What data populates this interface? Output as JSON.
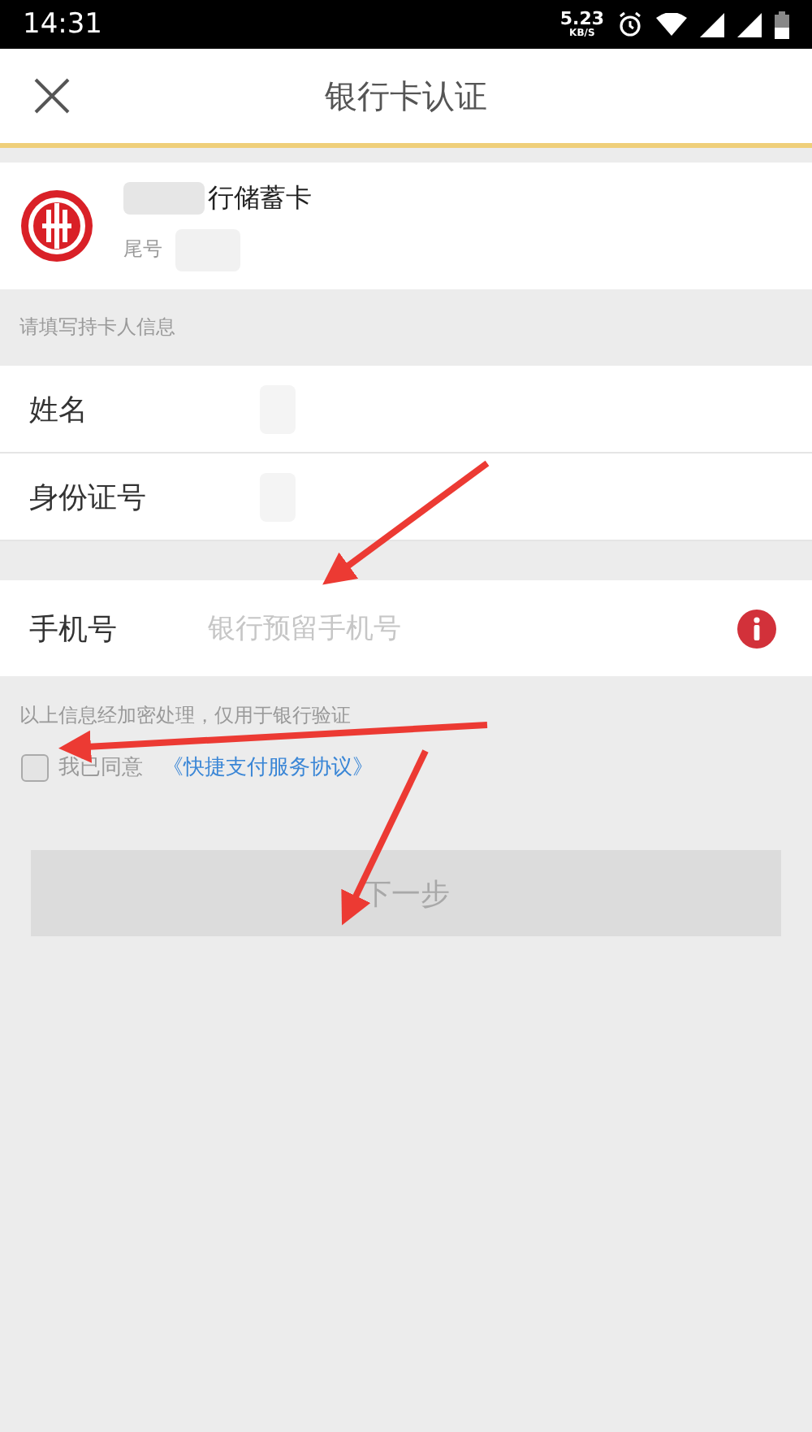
{
  "status_bar": {
    "time": "14:31",
    "speed": "5.23",
    "speed_unit": "KB/S"
  },
  "header": {
    "title": "银行卡认证"
  },
  "card": {
    "bank_name": "行储蓄卡",
    "tail_label": "尾号"
  },
  "section_label": "请填写持卡人信息",
  "fields": [
    {
      "label": "姓名",
      "kind": "blurred"
    },
    {
      "label": "身份证号",
      "kind": "blurred"
    }
  ],
  "phone": {
    "label": "手机号",
    "placeholder": "银行预留手机号"
  },
  "note": "以上信息经加密处理，仅用于银行验证",
  "agreement": {
    "checked": false,
    "text": "我已同意",
    "link": "《快捷支付服务协议》"
  },
  "next_button": {
    "label": "下一步",
    "disabled": true
  }
}
